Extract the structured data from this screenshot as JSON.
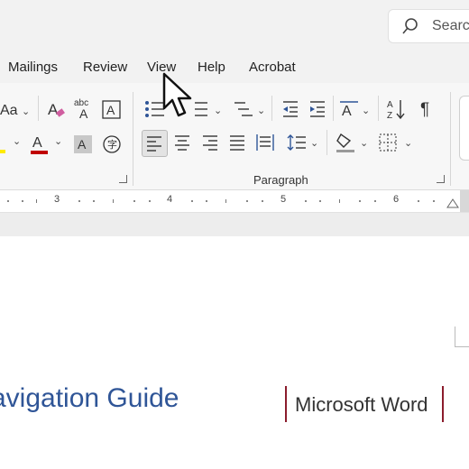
{
  "search": {
    "placeholder": "Search"
  },
  "menu": [
    "Mailings",
    "Review",
    "View",
    "Help",
    "Acrobat"
  ],
  "ribbon": {
    "group_label": "Paragraph",
    "font_size_label": "Aa"
  },
  "ruler": [
    "3",
    "4",
    "5",
    "6"
  ],
  "document": {
    "title": "avigation Guide",
    "brand": "Microsoft Word"
  },
  "colors": {
    "title": "#2f5597",
    "accent_line": "#8b1c2c",
    "font_color_bar": "#c00000",
    "highlight_bar": "#ffeb00"
  }
}
